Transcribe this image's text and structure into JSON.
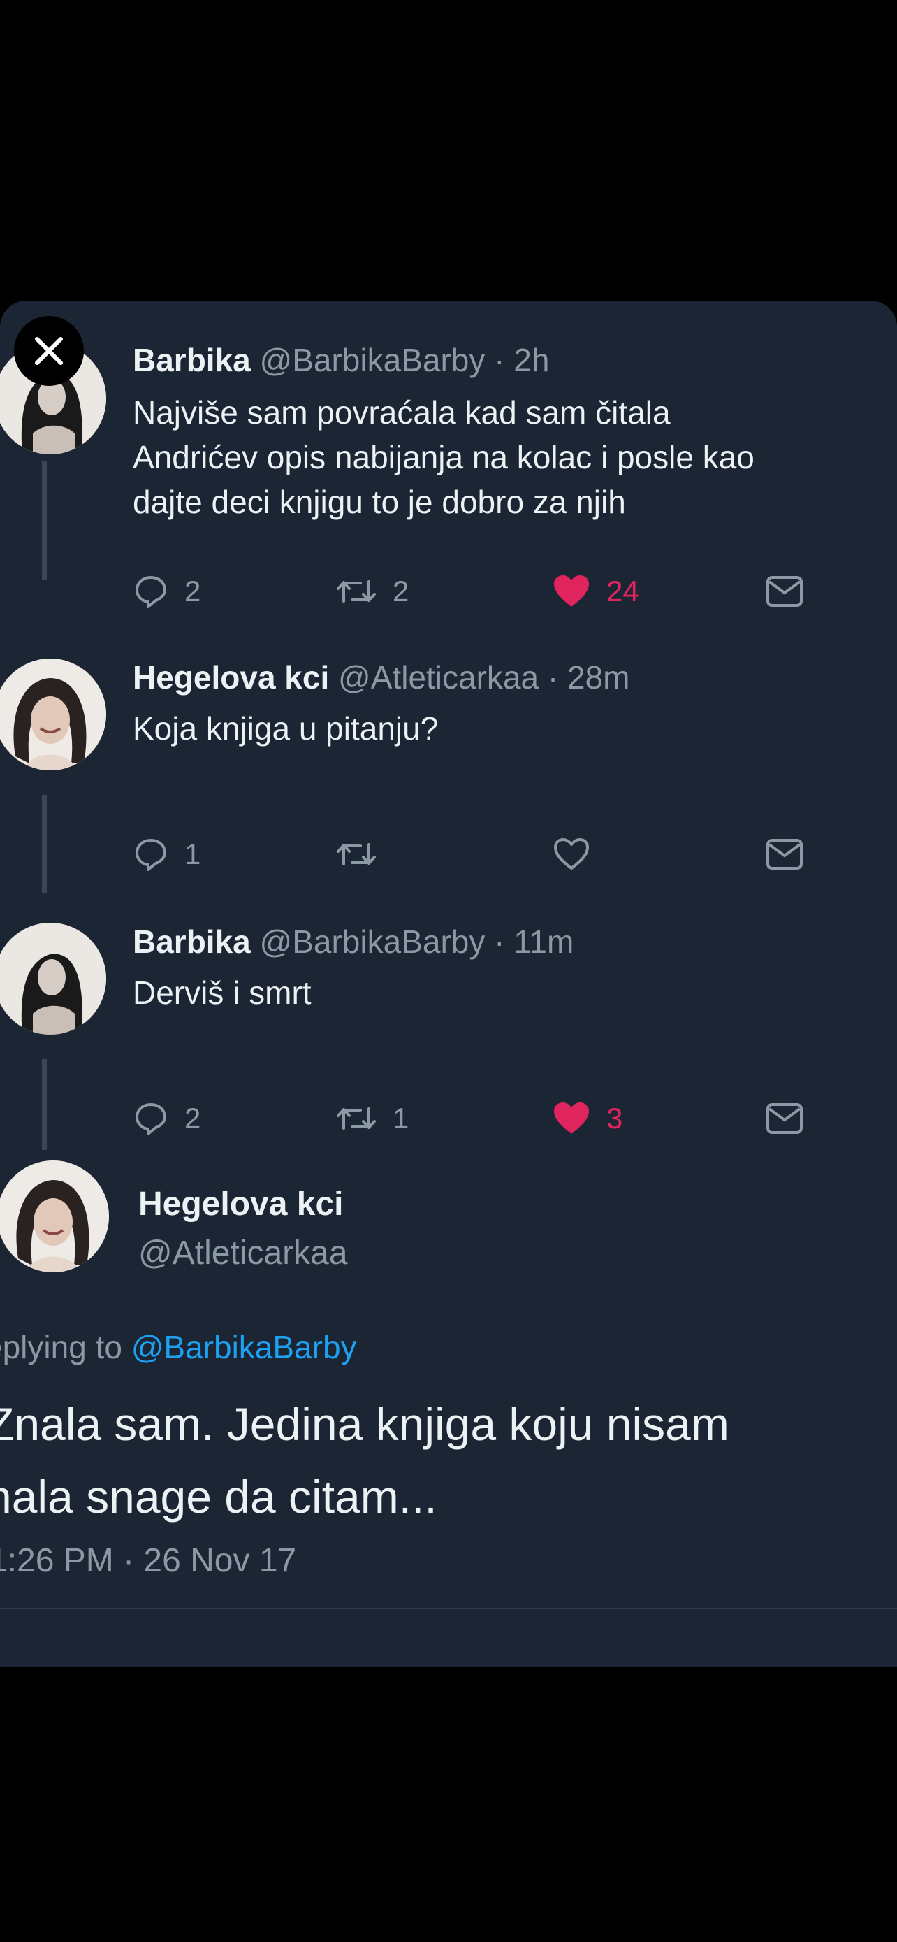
{
  "thread": [
    {
      "name": "Barbika",
      "handle": "@BarbikaBarby",
      "time": "· 2h",
      "text_lines": [
        "Najviše sam povraćala kad sam čitala",
        "Andrićev opis nabijanja na kolac i posle kao",
        "dajte deci knjigu to je dobro za njih"
      ],
      "replies": "2",
      "retweets": "2",
      "likes": "24",
      "liked": true
    },
    {
      "name": "Hegelova kci",
      "handle": "@Atleticarkaa",
      "time": "· 28m",
      "text_lines": [
        "Koja knjiga u pitanju?"
      ],
      "replies": "1",
      "retweets": "",
      "likes": "",
      "liked": false
    },
    {
      "name": "Barbika",
      "handle": "@BarbikaBarby",
      "time": "· 11m",
      "text_lines": [
        "Derviš i smrt"
      ],
      "replies": "2",
      "retweets": "1",
      "likes": "3",
      "liked": true
    }
  ],
  "main": {
    "name": "Hegelova kci",
    "handle": "@Atleticarkaa",
    "replying_prefix": "eplying to ",
    "replying_to": "@BarbikaBarby",
    "text_lines": [
      "Znala sam. Jedina knjiga koju nisam",
      "nala snage da citam..."
    ],
    "timestamp": "1:26 PM · 26 Nov 17"
  },
  "colors": {
    "card_bg": "#1c2533",
    "text": "#ecf1f4",
    "muted": "#8b98a5",
    "like": "#e0245e",
    "link": "#1da1f2"
  }
}
